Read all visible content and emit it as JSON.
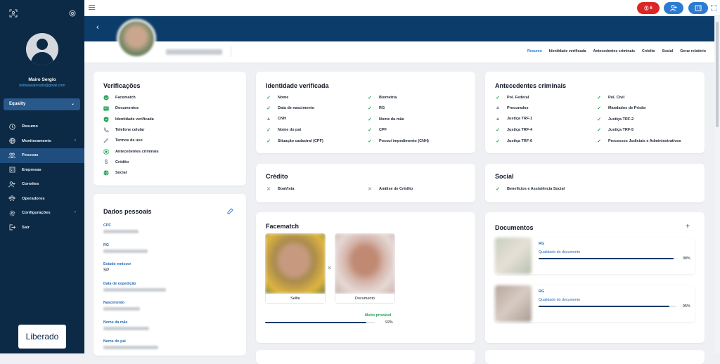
{
  "user": {
    "name": "Mairo Sergio",
    "email": "bolitaswatorado@gmail.com"
  },
  "org_select": {
    "value": "Equality"
  },
  "nav": [
    {
      "label": "Resumo",
      "icon": "clock-icon",
      "active": false,
      "arrow": false
    },
    {
      "label": "Monitoramento",
      "icon": "globe-icon",
      "active": false,
      "arrow": true
    },
    {
      "label": "Pessoas",
      "icon": "people-icon",
      "active": true,
      "arrow": false
    },
    {
      "label": "Empresas",
      "icon": "building-icon",
      "active": false,
      "arrow": false
    },
    {
      "label": "Convites",
      "icon": "user-plus-icon",
      "active": false,
      "arrow": false
    },
    {
      "label": "Operadores",
      "icon": "group-icon",
      "active": false,
      "arrow": false
    },
    {
      "label": "Configurações",
      "icon": "gear-icon",
      "active": false,
      "arrow": true
    },
    {
      "label": "Sair",
      "icon": "logout-icon",
      "active": false,
      "arrow": false
    }
  ],
  "logo": {
    "text": "Liberado"
  },
  "topbar": {
    "alert_count": "6"
  },
  "tabs": [
    "Resumo",
    "Identidade verificada",
    "Antecedentes criminais",
    "Crédito",
    "Social",
    "Gerar relatório"
  ],
  "verificacoes": {
    "title": "Verificações",
    "items": [
      {
        "label": "Facematch",
        "icon": "face-icon",
        "color": "#22a555"
      },
      {
        "label": "Documentos",
        "icon": "id-card-icon",
        "color": "#22a555"
      },
      {
        "label": "Identidade verificada",
        "icon": "shield-check-icon",
        "color": "#22a555"
      },
      {
        "label": "Telefone celular",
        "icon": "phone-icon",
        "color": "#8a93a0"
      },
      {
        "label": "Termos de uso",
        "icon": "pen-icon",
        "color": "#8a93a0"
      },
      {
        "label": "Antecedentes criminais",
        "icon": "badge-icon",
        "color": "#22a555"
      },
      {
        "label": "Crédito",
        "icon": "dollar-icon",
        "color": "#8a93a0"
      },
      {
        "label": "Social",
        "icon": "globe-icon",
        "color": "#22a555"
      }
    ]
  },
  "identidade": {
    "title": "Identidade verificada",
    "left": [
      {
        "label": "Nome",
        "status": "ok"
      },
      {
        "label": "Data de nascimento",
        "status": "ok"
      },
      {
        "label": "CNH",
        "status": "warn"
      },
      {
        "label": "Nome do pai",
        "status": "ok"
      },
      {
        "label": "Situação cadastral (CPF)",
        "status": "ok"
      }
    ],
    "right": [
      {
        "label": "Biometria",
        "status": "ok"
      },
      {
        "label": "RG",
        "status": "ok"
      },
      {
        "label": "Nome da mãe",
        "status": "ok"
      },
      {
        "label": "CPF",
        "status": "ok"
      },
      {
        "label": "Possui impedimento (CNH)",
        "status": "ok"
      }
    ]
  },
  "antecedentes": {
    "title": "Antecedentes criminais",
    "left": [
      {
        "label": "Pol. Federal",
        "status": "ok"
      },
      {
        "label": "Procurados",
        "status": "warn"
      },
      {
        "label": "Justiça TRF-1",
        "status": "warn"
      },
      {
        "label": "Justiça TRF-4",
        "status": "ok"
      },
      {
        "label": "Justiça TRF-6",
        "status": "ok"
      }
    ],
    "right": [
      {
        "label": "Pol. Civil",
        "status": "ok"
      },
      {
        "label": "Mandados de Prisão",
        "status": "ok"
      },
      {
        "label": "Justiça TRF-2",
        "status": "ok"
      },
      {
        "label": "Justiça TRF-5",
        "status": "ok"
      },
      {
        "label": "Processos Judiciais e Admininstrativos",
        "status": "ok"
      }
    ]
  },
  "credito": {
    "title": "Crédito",
    "items": [
      {
        "label": "BoaVista",
        "status": "no"
      },
      {
        "label": "Análise de Crédito",
        "status": "no"
      }
    ]
  },
  "social": {
    "title": "Social",
    "items": [
      {
        "label": "Benefícios e Assistência Social",
        "status": "ok"
      }
    ]
  },
  "dados": {
    "title": "Dados pessoais",
    "fields": [
      {
        "label": "CPF",
        "value": ""
      },
      {
        "label": "RG",
        "value": ""
      },
      {
        "label": "Estado emissor",
        "value": "SP"
      },
      {
        "label": "Data de expedição",
        "value": ""
      },
      {
        "label": "Nascimento",
        "value": ""
      },
      {
        "label": "Nome da mãe",
        "value": ""
      },
      {
        "label": "Nome do pai",
        "value": ""
      }
    ]
  },
  "facematch": {
    "title": "Facematch",
    "selfie_label": "Selfie",
    "doc_label": "Documento",
    "result": "Muito provável",
    "score_text": "92%",
    "score": 0.92
  },
  "documentos": {
    "title": "Documentos",
    "items": [
      {
        "type": "RG",
        "quality_label": "Qualidade do documento",
        "pct_text": "98%",
        "pct": 0.98
      },
      {
        "type": "RG",
        "quality_label": "Qualidade do documento",
        "pct_text": "95%",
        "pct": 0.95
      }
    ]
  }
}
